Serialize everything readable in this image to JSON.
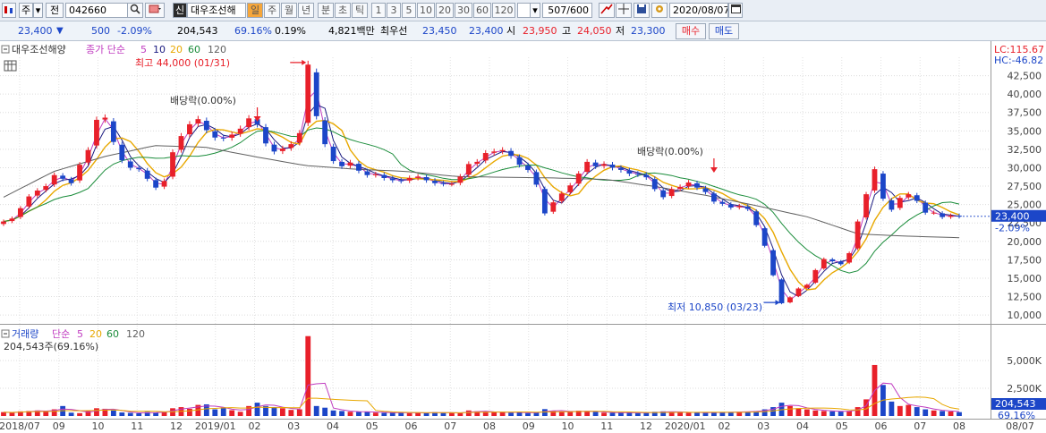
{
  "toolbar": {
    "market": "주",
    "prev": "전",
    "code": "042660",
    "badge_sin": "신",
    "stock_name": "대우조선해",
    "periods": [
      "일",
      "주",
      "월",
      "년",
      "분",
      "초",
      "틱"
    ],
    "active_period": "일",
    "intervals": [
      "1",
      "3",
      "5",
      "10",
      "20",
      "30",
      "60",
      "120"
    ],
    "count": "507/600",
    "date": "2020/08/07"
  },
  "infobar": {
    "price": "23,400",
    "change": "500",
    "change_pct": "-2.09%",
    "volume": "204,543",
    "vol_ratio": "69.16%",
    "turnover": "0.19%",
    "amount": "4,821백만",
    "best_label": "최우선",
    "best_ask": "23,450",
    "best_bid": "23,400",
    "open_label": "시",
    "open": "23,950",
    "high_label": "고",
    "high": "24,050",
    "low_label": "저",
    "low": "23,300",
    "buy_button": "매수",
    "sell_button": "매도"
  },
  "colors": {
    "up": "#e8202a",
    "down": "#1c46c8",
    "ma5": "#c03cc0",
    "ma10": "#1a1a80",
    "ma20": "#e8a800",
    "ma60": "#1a8c3a",
    "ma120": "#606060",
    "price_tag": "#1c46c8",
    "annotation": "#e8202a",
    "low_annotation": "#1c46c8"
  },
  "chart_data": {
    "type": "candlestick",
    "price_panel": {
      "legend": {
        "name": "대우조선해양",
        "series_label": "종가 단순",
        "mas": [
          "5",
          "10",
          "20",
          "60",
          "120"
        ]
      },
      "y_ticks": [
        "42,500",
        "40,000",
        "37,500",
        "35,000",
        "32,500",
        "30,000",
        "27,500",
        "25,000",
        "22,500",
        "20,000",
        "17,500",
        "15,000",
        "12,500",
        "10,000"
      ],
      "ylim": [
        8800,
        45000
      ],
      "lc_label": "LC:115.67",
      "hc_label": "HC:-46.82",
      "current_price": "23,400",
      "current_change": "-2.09%",
      "annotations": {
        "high": "최고 44,000 (01/31)",
        "low": "최저 10,850 (03/23)",
        "dividend1": "배당락(0.00%)",
        "dividend2": "배당락(0.00%)"
      },
      "close_series": [
        22700,
        23100,
        24500,
        26100,
        26900,
        27500,
        29000,
        28500,
        27900,
        30400,
        32400,
        36500,
        36800,
        33500,
        31000,
        30000,
        29800,
        28500,
        27300,
        28200,
        32100,
        34300,
        35900,
        36600,
        35100,
        34100,
        34000,
        34500,
        35300,
        36700,
        35900,
        33300,
        32200,
        32600,
        33200,
        34700,
        44000,
        37000,
        33200,
        30900,
        30200,
        30700,
        29600,
        29000,
        29100,
        28600,
        28300,
        28200,
        28600,
        28800,
        28300,
        27900,
        27800,
        27800,
        28800,
        30500,
        30800,
        32000,
        32200,
        32400,
        31600,
        30400,
        29700,
        27700,
        23800,
        25300,
        26500,
        27600,
        29200,
        30800,
        30200,
        30500,
        30000,
        29700,
        29200,
        29100,
        28700,
        27100,
        26000,
        27100,
        27400,
        28000,
        27300,
        26700,
        25400,
        25100,
        24600,
        24800,
        24400,
        22200,
        19400,
        15400,
        11600,
        12400,
        13600,
        14100,
        16100,
        17600,
        17300,
        16900,
        18400,
        22700,
        26400,
        29800,
        25800,
        24300,
        25900,
        26400,
        25500,
        23900,
        23900,
        23300,
        23500,
        23400
      ],
      "ma120_anchor_values": [
        26000,
        29500,
        31500,
        33000,
        32800,
        31500,
        30300,
        29800,
        29500,
        28800,
        28700,
        28600,
        28400,
        27400,
        26200,
        24800,
        23300,
        21000,
        20700,
        20500
      ]
    },
    "volume_panel": {
      "legend": {
        "name": "거래량",
        "series_label": "단순",
        "mas": [
          "5",
          "20",
          "60",
          "120"
        ]
      },
      "current_label": "204,543주(69.16%)",
      "y_ticks": [
        "5,000K",
        "2,500K"
      ],
      "current_volume": "204,543",
      "current_ratio": "69.16%",
      "volume_k": [
        350,
        300,
        420,
        450,
        500,
        380,
        600,
        900,
        300,
        260,
        450,
        700,
        650,
        500,
        320,
        280,
        240,
        360,
        300,
        380,
        700,
        800,
        650,
        1000,
        1050,
        600,
        720,
        520,
        380,
        900,
        1200,
        900,
        800,
        700,
        550,
        600,
        7200,
        900,
        750,
        500,
        450,
        380,
        360,
        400,
        300,
        280,
        320,
        300,
        260,
        300,
        280,
        350,
        280,
        300,
        260,
        500,
        420,
        380,
        320,
        360,
        300,
        340,
        260,
        300,
        620,
        480,
        360,
        400,
        480,
        420,
        380,
        300,
        280,
        320,
        300,
        260,
        300,
        380,
        420,
        350,
        340,
        300,
        320,
        280,
        340,
        350,
        360,
        380,
        400,
        450,
        600,
        800,
        1200,
        900,
        700,
        600,
        500,
        450,
        420,
        400,
        450,
        800,
        1500,
        4600,
        2800,
        1300,
        900,
        1000,
        800,
        600,
        500,
        450,
        400,
        350
      ]
    },
    "x_axis": {
      "labels": [
        "2018/07",
        "09",
        "10",
        "11",
        "12",
        "2019/01",
        "02",
        "03",
        "04",
        "05",
        "06",
        "07",
        "08",
        "09",
        "10",
        "11",
        "12",
        "2020/01",
        "02",
        "03",
        "04",
        "05",
        "06",
        "07",
        "08",
        "08/07"
      ]
    }
  }
}
